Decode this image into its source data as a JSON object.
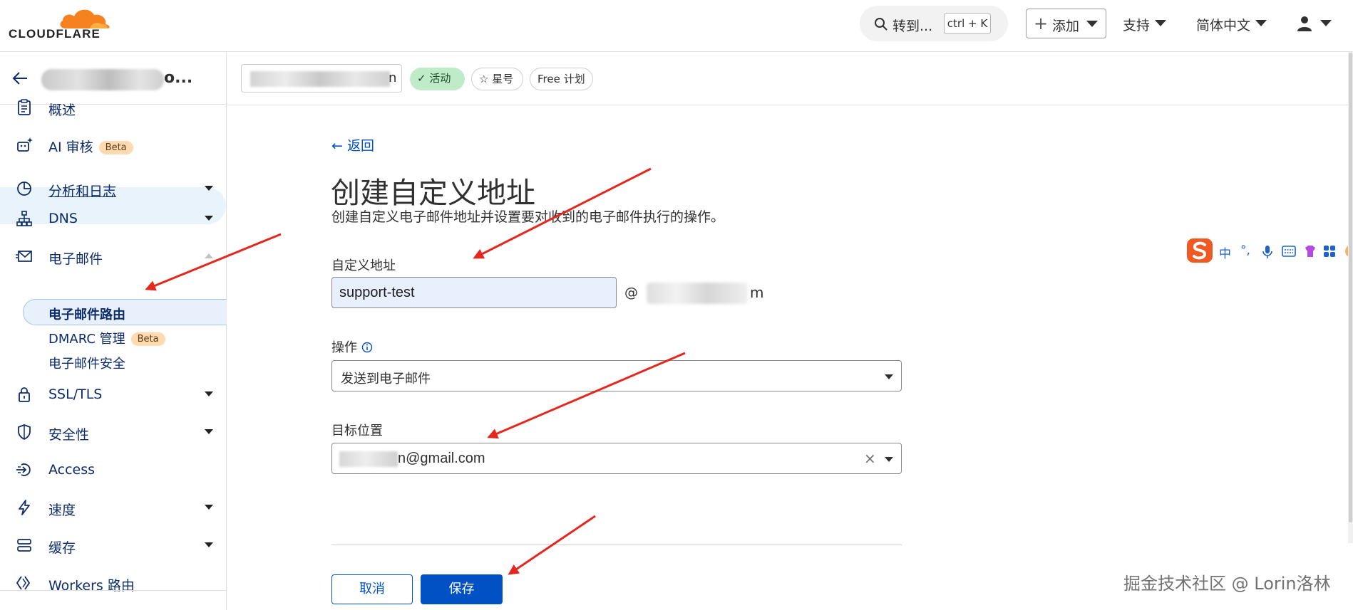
{
  "brand": {
    "logo_text": "CLOUDFLARE",
    "accent": "#F6821F"
  },
  "topbar": {
    "search_label": "转到...",
    "search_shortcut": "ctrl + K",
    "add_label": "添加",
    "support_label": "支持",
    "language_label": "简体中文"
  },
  "sidebar": {
    "site_suffix": "o...",
    "items": [
      {
        "label": "概述",
        "icon": "document-icon"
      },
      {
        "label": "AI 审核",
        "badge": "Beta",
        "icon": "robot-icon"
      },
      {
        "label": "分析和日志",
        "icon": "pie-chart-icon"
      },
      {
        "label": "DNS",
        "icon": "network-icon"
      },
      {
        "label": "电子邮件",
        "icon": "envelope-icon"
      },
      {
        "label": "SSL/TLS",
        "icon": "lock-icon"
      },
      {
        "label": "安全性",
        "icon": "shield-icon"
      },
      {
        "label": "Access",
        "icon": "access-icon"
      },
      {
        "label": "速度",
        "icon": "bolt-icon"
      },
      {
        "label": "缓存",
        "icon": "server-icon"
      },
      {
        "label": "Workers 路由",
        "icon": "workers-icon"
      }
    ],
    "email_subitems": [
      {
        "label": "电子邮件路由"
      },
      {
        "label": "DMARC 管理",
        "badge": "Beta"
      },
      {
        "label": "电子邮件安全"
      }
    ]
  },
  "zone_bar": {
    "status": "活动",
    "star_label": "星号",
    "plan_label": "Free 计划",
    "zone_suffix": "n"
  },
  "form": {
    "back_label": "返回",
    "title": "创建自定义地址",
    "subtitle": "创建自定义电子邮件地址并设置要对收到的电子邮件执行的操作。",
    "custom_address_label": "自定义地址",
    "custom_address_value": "support-test",
    "at": "@",
    "domain_suffix": "m",
    "action_label": "操作",
    "action_value": "发送到电子邮件",
    "destination_label": "目标位置",
    "destination_value": "n@gmail.com",
    "cancel_label": "取消",
    "save_label": "保存"
  },
  "ime": {
    "glyph_1": "中",
    "glyph_2": "°,"
  },
  "watermark": "掘金技术社区 @ Lorin洛林",
  "annotation_color": "#E5281F"
}
